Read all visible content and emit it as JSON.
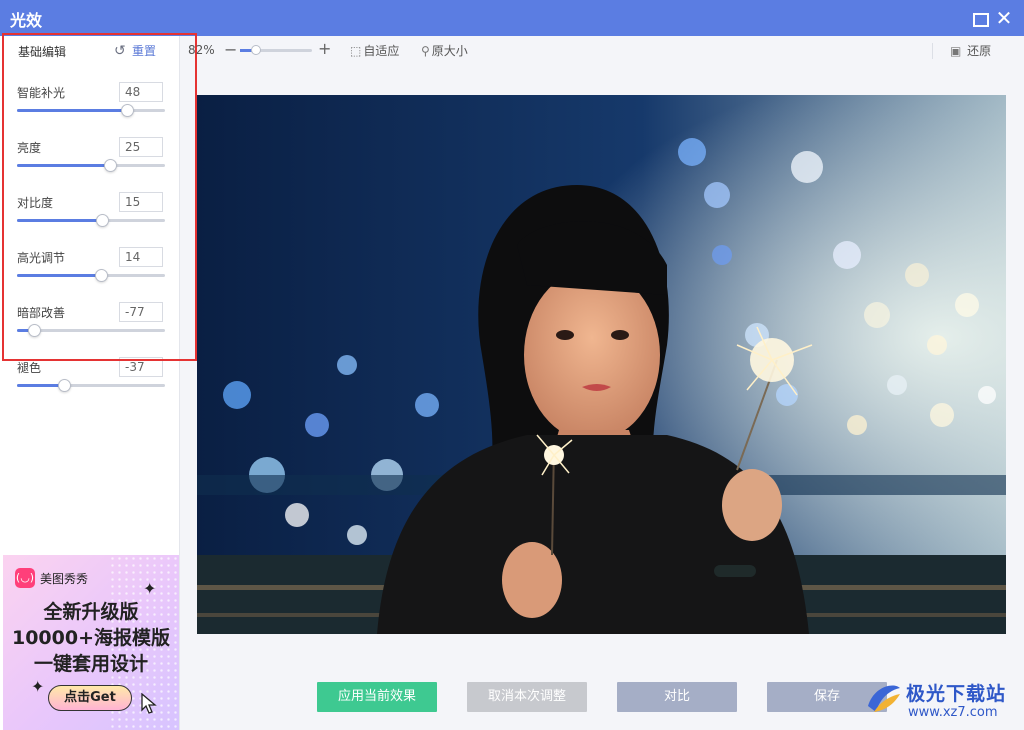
{
  "window": {
    "title": "光效",
    "maximize_icon": "maximize-icon",
    "close_icon": "close-icon",
    "close_glyph": "✕"
  },
  "sidebar": {
    "section_label": "基础编辑",
    "reset_label": "重置",
    "reset_icon": "undo-icon",
    "sliders": [
      {
        "label": "智能补光",
        "value": "48",
        "min": -100,
        "max": 100
      },
      {
        "label": "亮度",
        "value": "25",
        "min": -100,
        "max": 100
      },
      {
        "label": "对比度",
        "value": "15",
        "min": -100,
        "max": 100
      },
      {
        "label": "高光调节",
        "value": "14",
        "min": -100,
        "max": 100
      },
      {
        "label": "暗部改善",
        "value": "-77",
        "min": -100,
        "max": 100
      },
      {
        "label": "褪色",
        "value": "-37",
        "min": -100,
        "max": 100
      }
    ]
  },
  "ad": {
    "brand_logo_text": "(◡)",
    "brand": "美图秀秀",
    "line1": "全新升级版",
    "line2": "10000+海报模版",
    "line3": "一键套用设计",
    "cta": "点击Get"
  },
  "toolbar": {
    "zoom": "82%",
    "zoom_level": 0.22,
    "minus": "−",
    "plus": "+",
    "fit_label": "自适应",
    "fit_icon": "fit-window-icon",
    "original_label": "原大小",
    "original_icon": "zoom-icon",
    "restore_label": "还原",
    "restore_icon": "image-icon"
  },
  "actions": {
    "apply": "应用当前效果",
    "cancel": "取消本次调整",
    "compare": "对比",
    "save": "保存"
  },
  "watermark": {
    "title": "极光下载站",
    "url": "www.xz7.com"
  },
  "colors": {
    "accent": "#5b7de2",
    "apply": "#3ec991",
    "highlight": "#e53333"
  }
}
